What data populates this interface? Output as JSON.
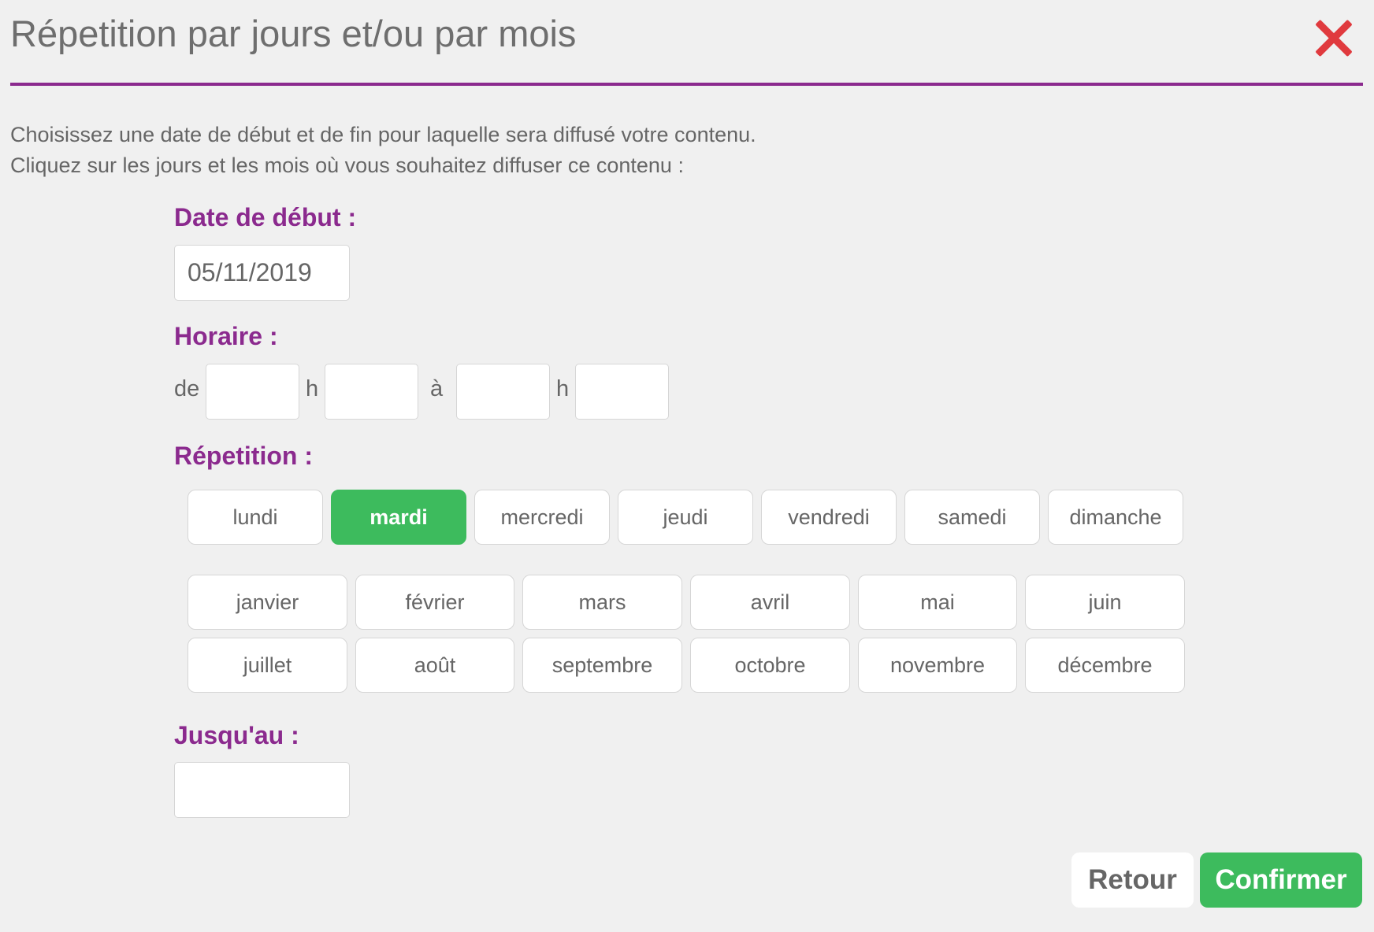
{
  "dialog": {
    "title": "Répetition par jours et/ou par mois"
  },
  "intro": {
    "line1": "Choisissez une date de début et de fin pour laquelle sera diffusé votre contenu.",
    "line2": "Cliquez sur les jours et les mois où vous souhaitez diffuser ce contenu :"
  },
  "start_date": {
    "label": "Date de début :",
    "value": "05/11/2019"
  },
  "schedule": {
    "label": "Horaire :",
    "from_label": "de",
    "hour_label_1": "h",
    "to_label": "à",
    "hour_label_2": "h",
    "from_hour": "",
    "from_minute": "",
    "to_hour": "",
    "to_minute": ""
  },
  "repetition": {
    "label": "Répetition :",
    "days": [
      "lundi",
      "mardi",
      "mercredi",
      "jeudi",
      "vendredi",
      "samedi",
      "dimanche"
    ],
    "selected_day": "mardi",
    "months": [
      "janvier",
      "février",
      "mars",
      "avril",
      "mai",
      "juin",
      "juillet",
      "août",
      "septembre",
      "octobre",
      "novembre",
      "décembre"
    ]
  },
  "end_date": {
    "label": "Jusqu'au :",
    "value": ""
  },
  "actions": {
    "back_label": "Retour",
    "confirm_label": "Confirmer"
  },
  "colors": {
    "accent": "#8b2a8e",
    "selected": "#3dbb5d",
    "close": "#e03a3e"
  }
}
